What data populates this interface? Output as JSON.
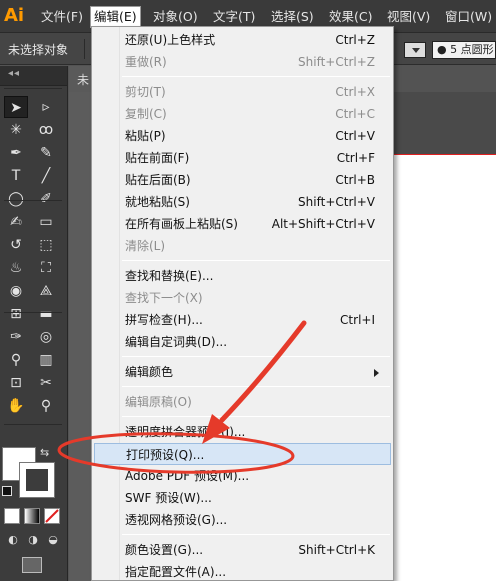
{
  "app": {
    "logo": "Ai"
  },
  "menubar": {
    "items": [
      {
        "label": "文件(F)"
      },
      {
        "label": "编辑(E)"
      },
      {
        "label": "对象(O)"
      },
      {
        "label": "文字(T)"
      },
      {
        "label": "选择(S)"
      },
      {
        "label": "效果(C)"
      },
      {
        "label": "视图(V)"
      },
      {
        "label": "窗口(W)"
      }
    ],
    "active_item": "编辑(E)"
  },
  "control_bar": {
    "selection_status": "未选择对象",
    "stroke_profile": "5 点圆形"
  },
  "document": {
    "tab_label": "未"
  },
  "edit_menu": {
    "groups": [
      [
        {
          "label": "还原(U)上色样式",
          "shortcut": "Ctrl+Z",
          "disabled": false
        },
        {
          "label": "重做(R)",
          "shortcut": "Shift+Ctrl+Z",
          "disabled": true
        }
      ],
      [
        {
          "label": "剪切(T)",
          "shortcut": "Ctrl+X",
          "disabled": true
        },
        {
          "label": "复制(C)",
          "shortcut": "Ctrl+C",
          "disabled": true
        },
        {
          "label": "粘贴(P)",
          "shortcut": "Ctrl+V",
          "disabled": false
        },
        {
          "label": "贴在前面(F)",
          "shortcut": "Ctrl+F",
          "disabled": false
        },
        {
          "label": "贴在后面(B)",
          "shortcut": "Ctrl+B",
          "disabled": false
        },
        {
          "label": "就地粘贴(S)",
          "shortcut": "Shift+Ctrl+V",
          "disabled": false
        },
        {
          "label": "在所有画板上粘贴(S)",
          "shortcut": "Alt+Shift+Ctrl+V",
          "disabled": false
        },
        {
          "label": "清除(L)",
          "shortcut": "",
          "disabled": true
        }
      ],
      [
        {
          "label": "查找和替换(E)...",
          "shortcut": "",
          "disabled": false
        },
        {
          "label": "查找下一个(X)",
          "shortcut": "",
          "disabled": true
        },
        {
          "label": "拼写检查(H)...",
          "shortcut": "Ctrl+I",
          "disabled": false
        },
        {
          "label": "编辑自定词典(D)...",
          "shortcut": "",
          "disabled": false
        }
      ],
      [
        {
          "label": "编辑颜色",
          "shortcut": "",
          "disabled": false,
          "submenu": true
        }
      ],
      [
        {
          "label": "编辑原稿(O)",
          "shortcut": "",
          "disabled": true
        }
      ],
      [
        {
          "label": "透明度拼合器预设(J)...",
          "shortcut": "",
          "disabled": false
        },
        {
          "label": "打印预设(Q)...",
          "shortcut": "",
          "disabled": false,
          "highlighted": true
        },
        {
          "label": "Adobe PDF 预设(M)...",
          "shortcut": "",
          "disabled": false
        },
        {
          "label": "SWF 预设(W)...",
          "shortcut": "",
          "disabled": false
        },
        {
          "label": "透视网格预设(G)...",
          "shortcut": "",
          "disabled": false
        }
      ],
      [
        {
          "label": "颜色设置(G)...",
          "shortcut": "Shift+Ctrl+K",
          "disabled": false
        },
        {
          "label": "指定配置文件(A)...",
          "shortcut": "",
          "disabled": false
        }
      ]
    ]
  },
  "tools": {
    "icons": [
      "selection-tool-icon",
      "direct-selection-tool-icon",
      "magic-wand-tool-icon",
      "lasso-tool-icon",
      "pen-tool-icon",
      "curvature-tool-icon",
      "type-tool-icon",
      "line-tool-icon",
      "ellipse-tool-icon",
      "paintbrush-tool-icon",
      "blob-brush-tool-icon",
      "eraser-tool-icon",
      "rotate-tool-icon",
      "scale-tool-icon",
      "warp-tool-icon",
      "free-transform-tool-icon",
      "shape-builder-tool-icon",
      "perspective-grid-tool-icon",
      "mesh-tool-icon",
      "gradient-tool-icon",
      "eyedropper-tool-icon",
      "blend-tool-icon",
      "symbol-sprayer-tool-icon",
      "column-graph-tool-icon",
      "artboard-tool-icon",
      "slice-tool-icon",
      "hand-tool-icon",
      "zoom-tool-icon"
    ]
  },
  "colors": {
    "annotation": "#e53a2a",
    "menu_highlight": "#d7e6f6",
    "artboard_edge": "#e02020"
  }
}
